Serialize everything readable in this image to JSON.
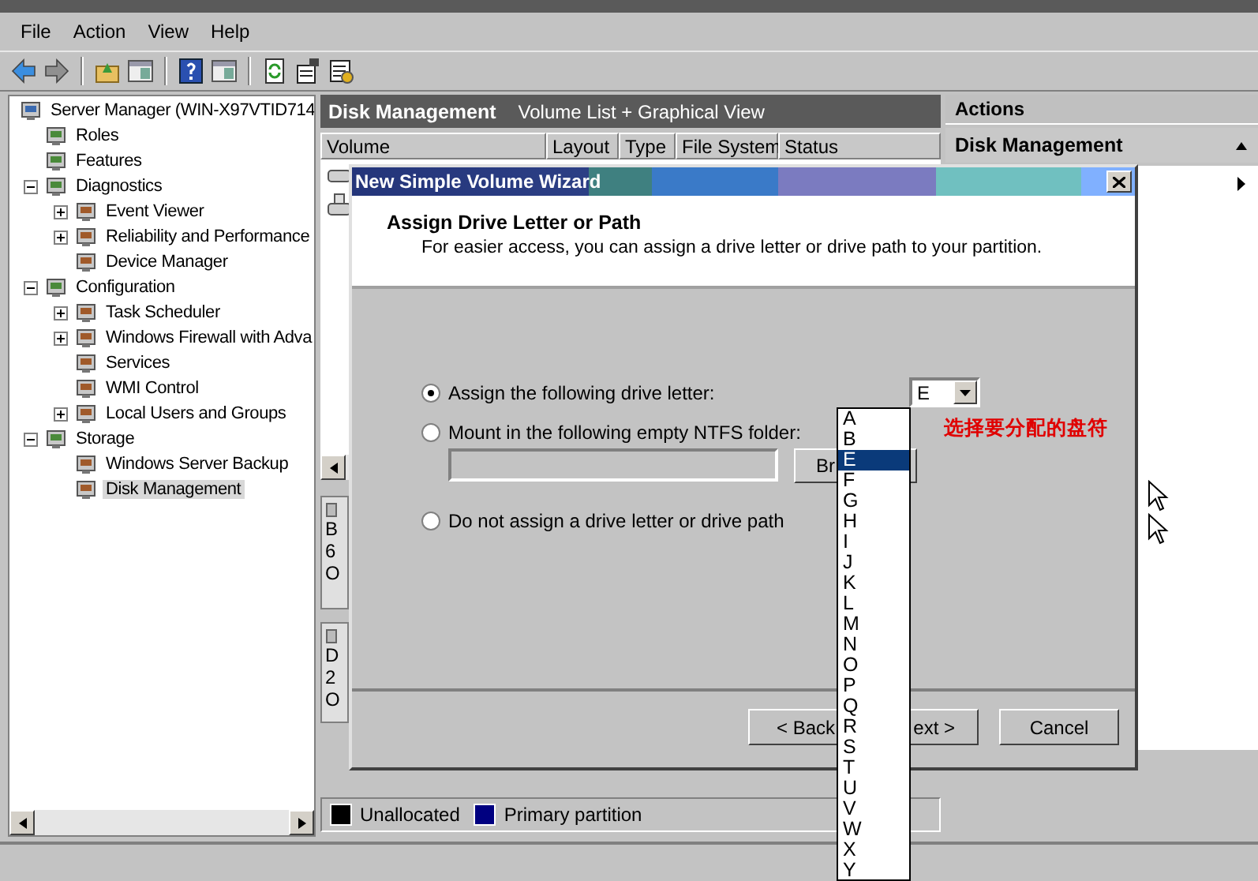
{
  "menu": [
    {
      "label": "File"
    },
    {
      "label": "Action"
    },
    {
      "label": "View"
    },
    {
      "label": "Help"
    }
  ],
  "tree": [
    {
      "label": "Server Manager (WIN-X97VTID714",
      "selected": false,
      "children": [
        {
          "label": "Roles",
          "selected": false
        },
        {
          "label": "Features",
          "selected": false
        },
        {
          "label": "Diagnostics",
          "expanded": true,
          "selected": false,
          "children": [
            {
              "label": "Event Viewer",
              "expanded": false,
              "selected": false
            },
            {
              "label": "Reliability and Performance",
              "expanded": false,
              "selected": false
            },
            {
              "label": "Device Manager",
              "selected": false
            }
          ]
        },
        {
          "label": "Configuration",
          "expanded": true,
          "selected": false,
          "children": [
            {
              "label": "Task Scheduler",
              "expanded": false,
              "selected": false
            },
            {
              "label": "Windows Firewall with Adva",
              "expanded": false,
              "selected": false
            },
            {
              "label": "Services",
              "selected": false
            },
            {
              "label": "WMI Control",
              "selected": false
            },
            {
              "label": "Local Users and Groups",
              "expanded": false,
              "selected": false
            }
          ]
        },
        {
          "label": "Storage",
          "expanded": true,
          "selected": false,
          "children": [
            {
              "label": "Windows Server Backup",
              "selected": false
            },
            {
              "label": "Disk Management",
              "selected": true
            }
          ]
        }
      ]
    }
  ],
  "center": {
    "title": "Disk Management",
    "subtitle": "Volume List + Graphical View",
    "columns": [
      "Volume",
      "Layout",
      "Type",
      "File System",
      "Status"
    ],
    "disks": [
      {
        "lines": [
          "B",
          "6",
          "O"
        ]
      },
      {
        "lines": [
          "D",
          "2",
          "O"
        ]
      }
    ],
    "legend": [
      {
        "label": "Unallocated",
        "color": "#000000"
      },
      {
        "label": "Primary partition",
        "color": "#000080"
      }
    ]
  },
  "actions": {
    "title": "Actions",
    "section": "Disk Management"
  },
  "wizard": {
    "title": "New Simple Volume Wizard",
    "heading": "Assign Drive Letter or Path",
    "description": "For easier access, you can assign a drive letter or drive path to your partition.",
    "options": [
      {
        "label": "Assign the following drive letter:",
        "selected": true
      },
      {
        "label": "Mount in the following empty NTFS folder:",
        "selected": false
      },
      {
        "label": "Do not assign a drive letter or drive path",
        "selected": false
      }
    ],
    "drive_letter": "E",
    "browse_button": "Br",
    "buttons": [
      {
        "label": "< Back"
      },
      {
        "label": "ext >"
      },
      {
        "label": "Cancel"
      }
    ],
    "dropdown": [
      {
        "label": "A",
        "selected": false
      },
      {
        "label": "B",
        "selected": false
      },
      {
        "label": "E",
        "selected": true
      },
      {
        "label": "F",
        "selected": false
      },
      {
        "label": "G",
        "selected": false
      },
      {
        "label": "H",
        "selected": false
      },
      {
        "label": "I",
        "selected": false
      },
      {
        "label": "J",
        "selected": false
      },
      {
        "label": "K",
        "selected": false
      },
      {
        "label": "L",
        "selected": false
      },
      {
        "label": "M",
        "selected": false
      },
      {
        "label": "N",
        "selected": false
      },
      {
        "label": "O",
        "selected": false
      },
      {
        "label": "P",
        "selected": false
      },
      {
        "label": "Q",
        "selected": false
      },
      {
        "label": "R",
        "selected": false
      },
      {
        "label": "S",
        "selected": false
      },
      {
        "label": "T",
        "selected": false
      },
      {
        "label": "U",
        "selected": false
      },
      {
        "label": "V",
        "selected": false
      },
      {
        "label": "W",
        "selected": false
      },
      {
        "label": "X",
        "selected": false
      },
      {
        "label": "Y",
        "selected": false
      }
    ]
  },
  "annotation": "选择要分配的盘符"
}
